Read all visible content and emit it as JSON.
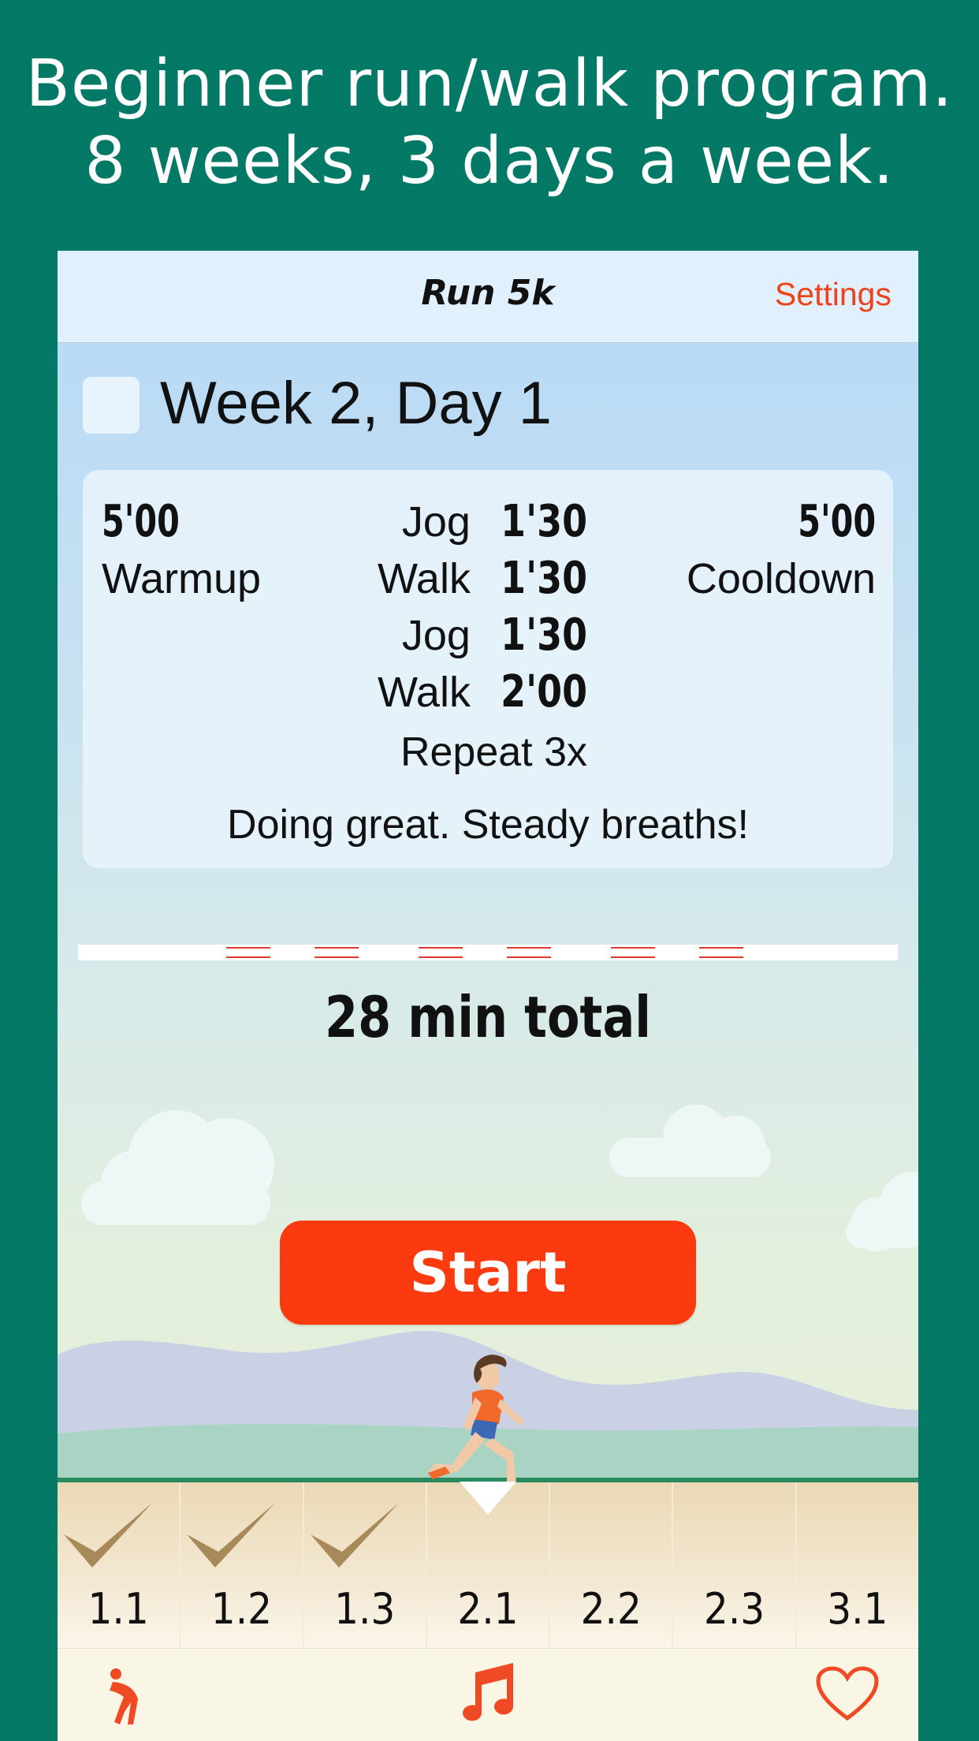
{
  "promo": {
    "line1": "Beginner run/walk program.",
    "line2": "8 weeks, 3 days a week."
  },
  "nav": {
    "title": "Run 5k",
    "settings_label": "Settings"
  },
  "workout": {
    "title": "Week 2, Day 1",
    "completed": false,
    "warmup": {
      "time": "5'00",
      "label": "Warmup"
    },
    "cooldown": {
      "time": "5'00",
      "label": "Cooldown"
    },
    "intervals": [
      {
        "label": "Jog",
        "duration": "1'30"
      },
      {
        "label": "Walk",
        "duration": "1'30"
      },
      {
        "label": "Jog",
        "duration": "1'30"
      },
      {
        "label": "Walk",
        "duration": "2'00"
      }
    ],
    "repeat": "Repeat 3x",
    "encouragement": "Doing great. Steady breaths!",
    "total": "28 min total"
  },
  "start_label": "Start",
  "days": [
    {
      "label": "1.1",
      "done": true
    },
    {
      "label": "1.2",
      "done": true
    },
    {
      "label": "1.3",
      "done": true
    },
    {
      "label": "2.1",
      "done": false,
      "current": true
    },
    {
      "label": "2.2",
      "done": false
    },
    {
      "label": "2.3",
      "done": false
    },
    {
      "label": "3.1",
      "done": false
    }
  ],
  "tabs": [
    {
      "icon": "stretch-icon"
    },
    {
      "icon": "music-note-icon"
    },
    {
      "icon": "heart-icon"
    }
  ],
  "colors": {
    "background": "#047a66",
    "accent": "#fb3b0f",
    "settings": "#f0421a"
  }
}
